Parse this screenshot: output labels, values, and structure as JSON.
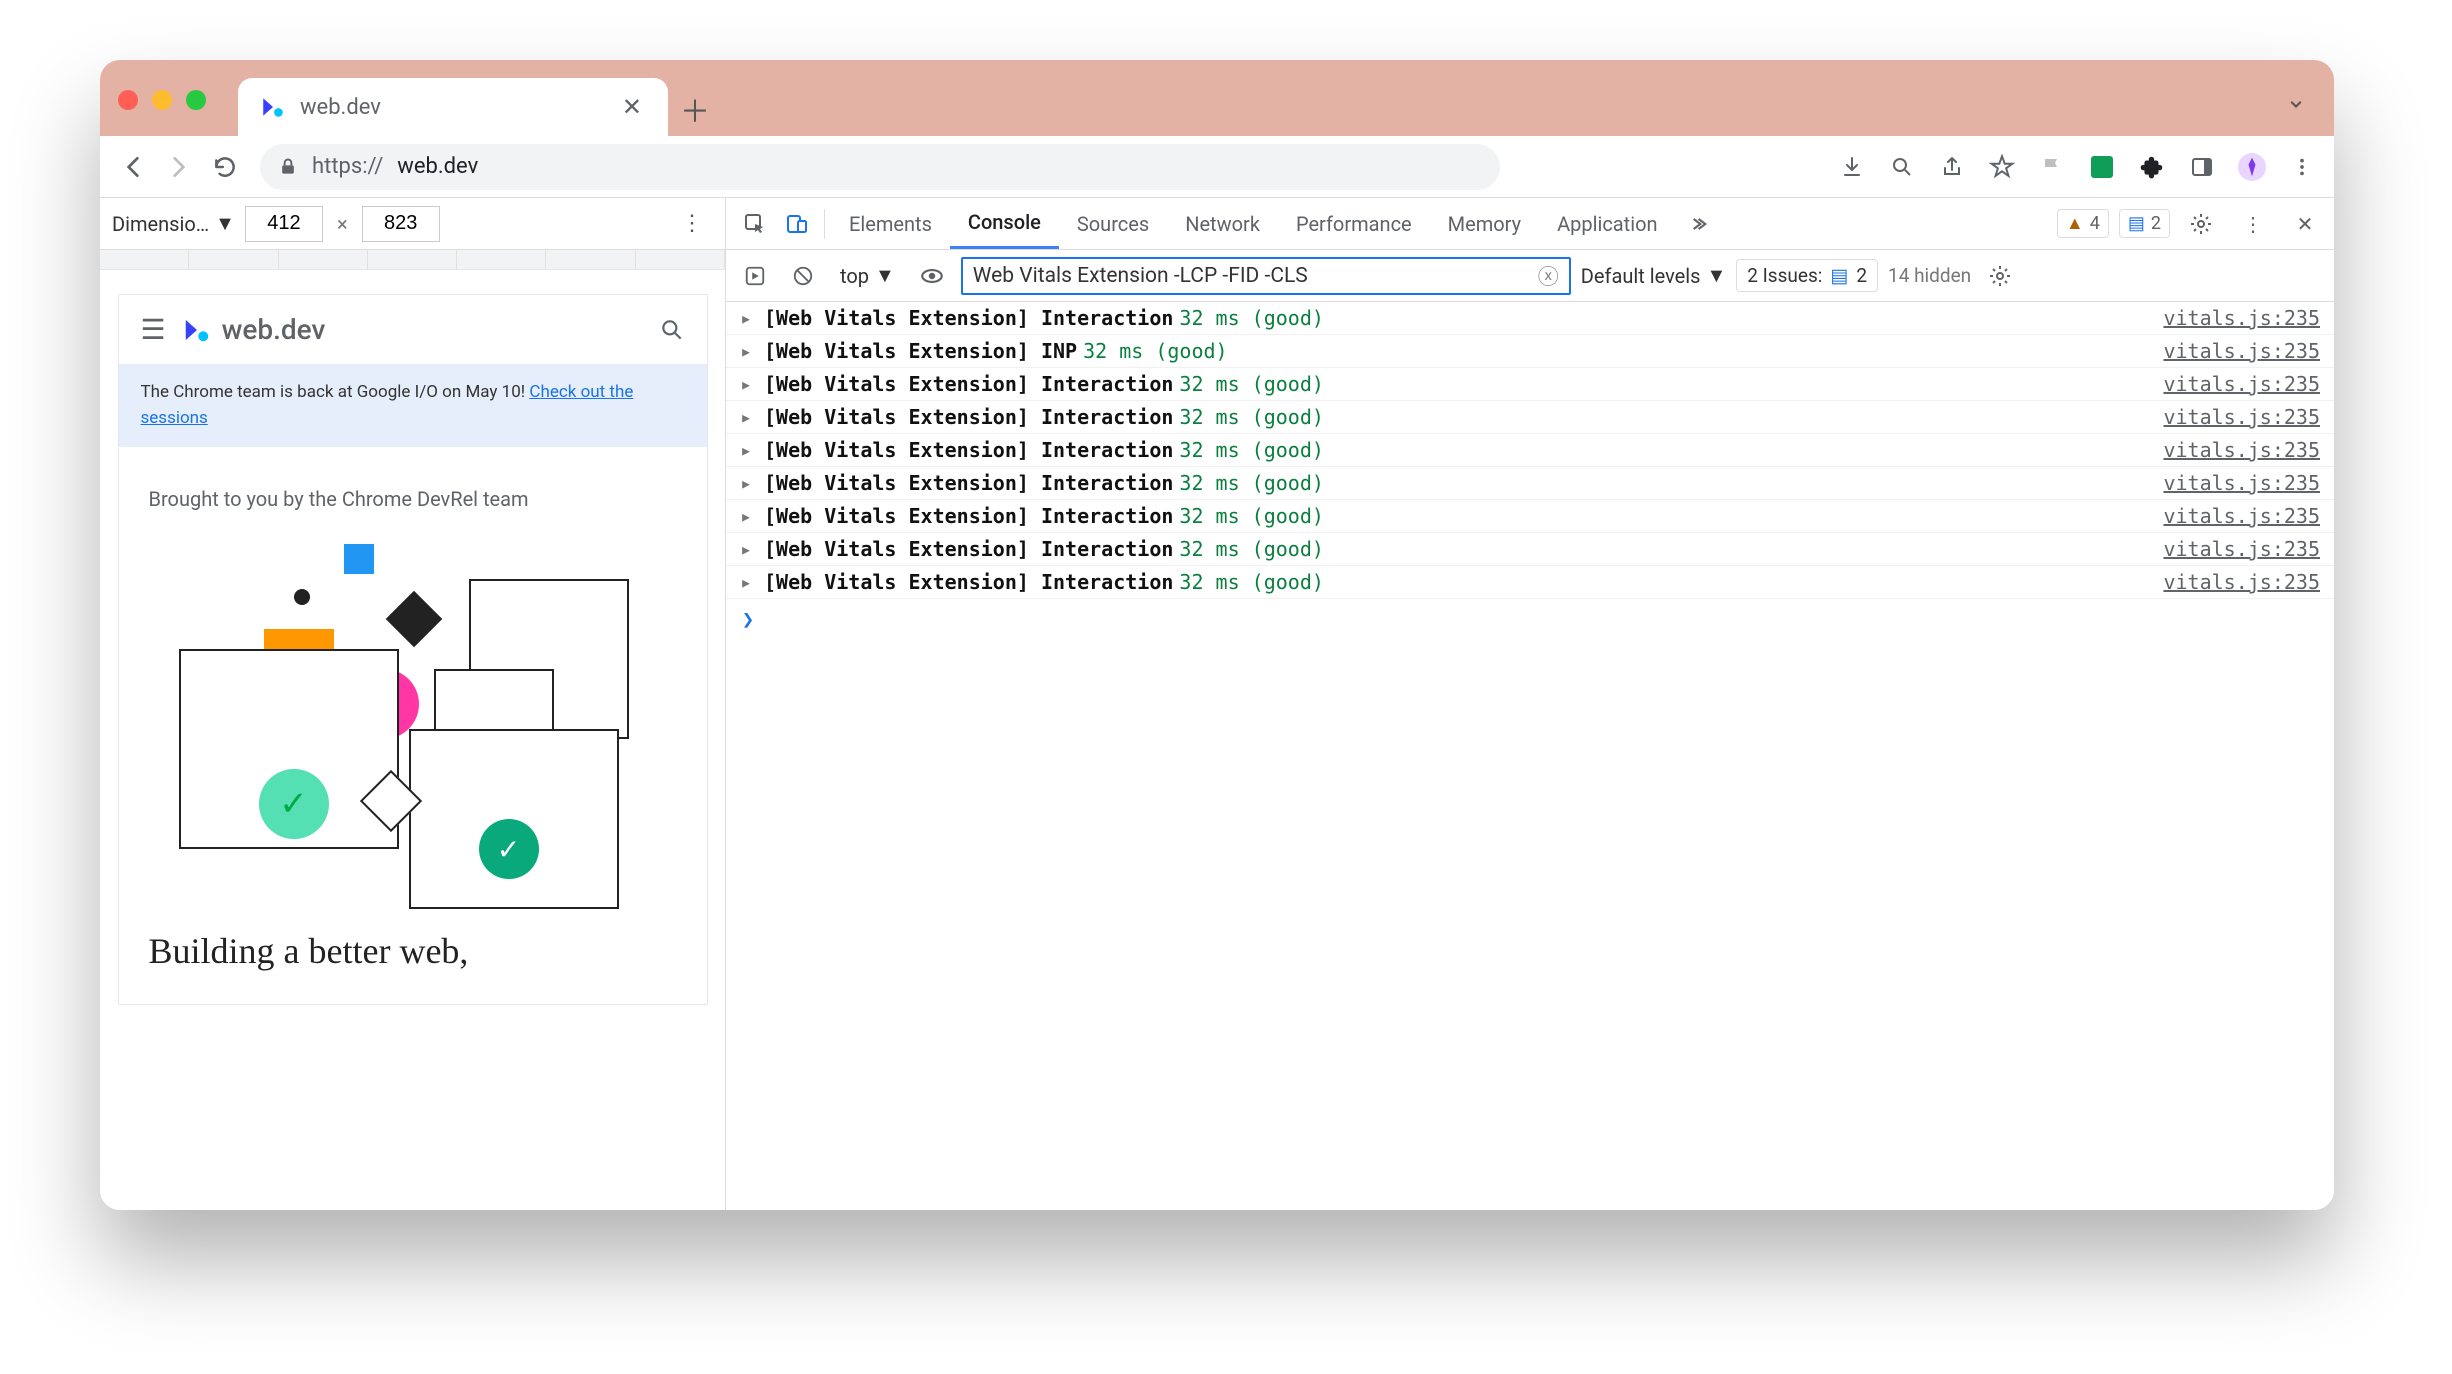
{
  "chrome": {
    "tab_title": "web.dev",
    "url_prefix": "https://",
    "url_main": "web.dev"
  },
  "device_bar": {
    "dimensions_label": "Dimensio…",
    "width": "412",
    "height": "823"
  },
  "mock_page": {
    "brand": "web.dev",
    "banner_text": "The Chrome team is back at Google I/O on May 10! ",
    "banner_link": "Check out the sessions",
    "subtitle": "Brought to you by the Chrome DevRel team",
    "headline": "Building a better web,"
  },
  "devtools": {
    "tabs": [
      "Elements",
      "Console",
      "Sources",
      "Network",
      "Performance",
      "Memory",
      "Application"
    ],
    "active_tab": "Console",
    "warnings_count": "4",
    "messages_count": "2",
    "context_label": "top",
    "filter_value": "Web Vitals Extension -LCP -FID -CLS",
    "levels_label": "Default levels",
    "issues_label": "2 Issues:",
    "issues_count": "2",
    "hidden_label": "14 hidden"
  },
  "console_rows": [
    {
      "prefix": "[Web Vitals Extension]",
      "metric": "Interaction",
      "timing": "32 ms (good)",
      "src": "vitals.js:235"
    },
    {
      "prefix": "[Web Vitals Extension]",
      "metric": "INP",
      "timing": "32 ms (good)",
      "src": "vitals.js:235"
    },
    {
      "prefix": "[Web Vitals Extension]",
      "metric": "Interaction",
      "timing": "32 ms (good)",
      "src": "vitals.js:235"
    },
    {
      "prefix": "[Web Vitals Extension]",
      "metric": "Interaction",
      "timing": "32 ms (good)",
      "src": "vitals.js:235"
    },
    {
      "prefix": "[Web Vitals Extension]",
      "metric": "Interaction",
      "timing": "32 ms (good)",
      "src": "vitals.js:235"
    },
    {
      "prefix": "[Web Vitals Extension]",
      "metric": "Interaction",
      "timing": "32 ms (good)",
      "src": "vitals.js:235"
    },
    {
      "prefix": "[Web Vitals Extension]",
      "metric": "Interaction",
      "timing": "32 ms (good)",
      "src": "vitals.js:235"
    },
    {
      "prefix": "[Web Vitals Extension]",
      "metric": "Interaction",
      "timing": "32 ms (good)",
      "src": "vitals.js:235"
    },
    {
      "prefix": "[Web Vitals Extension]",
      "metric": "Interaction",
      "timing": "32 ms (good)",
      "src": "vitals.js:235"
    }
  ]
}
